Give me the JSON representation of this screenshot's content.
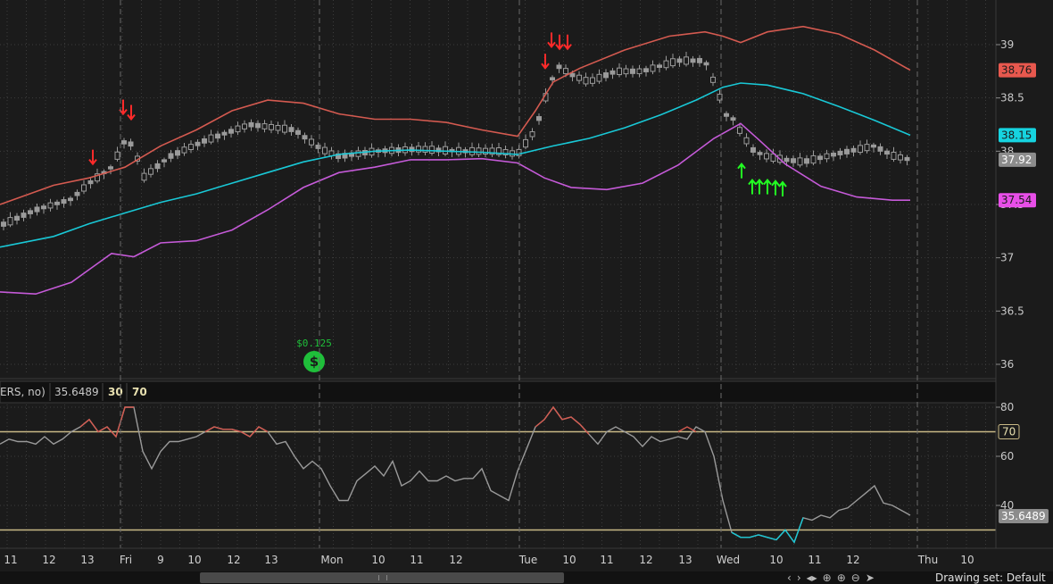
{
  "chart_data": [
    {
      "type": "candlestick",
      "ylim": [
        35.95,
        39.2
      ],
      "y_ticks": [
        "39",
        "38.5",
        "38",
        "37.5",
        "37",
        "36.5",
        "36"
      ],
      "price_badges": [
        {
          "label": "38.76",
          "value": 38.76,
          "color": "#e8584e",
          "text_color": "#1b1b1b"
        },
        {
          "label": "38.15",
          "value": 38.15,
          "color": "#16d4e0",
          "text_color": "#1b1b1b"
        },
        {
          "label": "37.92",
          "value": 37.92,
          "color": "#8c8c8c",
          "text_color": "#ffffff"
        },
        {
          "label": "37.54",
          "value": 37.54,
          "color": "#e84ee8",
          "text_color": "#1b1b1b"
        }
      ],
      "series": [
        {
          "role": "upper-band",
          "color": "#d45a50",
          "x": [
            0,
            60,
            100,
            140,
            180,
            220,
            260,
            300,
            340,
            380,
            420,
            460,
            500,
            540,
            580,
            600,
            620,
            650,
            700,
            750,
            790,
            810,
            830,
            860,
            900,
            940,
            980,
            1020
          ],
          "y": [
            37.5,
            37.68,
            37.75,
            37.85,
            38.05,
            38.2,
            38.38,
            38.48,
            38.45,
            38.35,
            38.3,
            38.3,
            38.27,
            38.2,
            38.14,
            38.38,
            38.65,
            38.78,
            38.95,
            39.08,
            39.12,
            39.08,
            39.02,
            39.12,
            39.17,
            39.1,
            38.95,
            38.76
          ]
        },
        {
          "role": "middle-band",
          "color": "#19c8d6",
          "x": [
            0,
            60,
            100,
            140,
            180,
            220,
            260,
            300,
            340,
            380,
            420,
            460,
            500,
            540,
            580,
            620,
            660,
            700,
            740,
            780,
            810,
            830,
            860,
            900,
            940,
            980,
            1020
          ],
          "y": [
            37.1,
            37.2,
            37.32,
            37.42,
            37.52,
            37.6,
            37.7,
            37.8,
            37.9,
            37.97,
            38.0,
            38.01,
            38.0,
            37.99,
            37.97,
            38.05,
            38.12,
            38.22,
            38.34,
            38.48,
            38.6,
            38.64,
            38.62,
            38.54,
            38.42,
            38.29,
            38.15
          ]
        },
        {
          "role": "lower-band",
          "color": "#c55ad8",
          "x": [
            0,
            40,
            80,
            110,
            125,
            150,
            180,
            220,
            260,
            300,
            340,
            380,
            420,
            460,
            500,
            540,
            580,
            610,
            640,
            680,
            720,
            760,
            800,
            830,
            850,
            880,
            920,
            960,
            1000,
            1020
          ],
          "y": [
            36.68,
            36.66,
            36.77,
            36.95,
            37.04,
            37.01,
            37.14,
            37.16,
            37.26,
            37.45,
            37.66,
            37.8,
            37.85,
            37.92,
            37.92,
            37.93,
            37.89,
            37.75,
            37.66,
            37.64,
            37.7,
            37.87,
            38.12,
            38.26,
            38.11,
            37.88,
            37.67,
            37.57,
            37.54,
            37.54
          ]
        }
      ],
      "markers": {
        "sell_arrows": [
          {
            "x": 104,
            "y": 37.88
          },
          {
            "x": 138,
            "y": 38.35
          },
          {
            "x": 147,
            "y": 38.3
          },
          {
            "x": 611,
            "y": 38.78
          },
          {
            "x": 618,
            "y": 38.98
          },
          {
            "x": 627,
            "y": 38.96
          },
          {
            "x": 636,
            "y": 38.96
          }
        ],
        "buy_arrows": [
          {
            "x": 831,
            "y": 37.88
          },
          {
            "x": 843,
            "y": 37.73
          },
          {
            "x": 851,
            "y": 37.73
          },
          {
            "x": 860,
            "y": 37.73
          },
          {
            "x": 869,
            "y": 37.72
          },
          {
            "x": 877,
            "y": 37.71
          }
        ]
      },
      "dividend": {
        "label": "$0.125",
        "x": 352
      }
    },
    {
      "type": "line",
      "ylim": [
        24,
        83
      ],
      "y_ticks": [
        "80",
        "60",
        "40"
      ],
      "header": {
        "study": "ERS, no)",
        "value": "35.6489",
        "oversold": "30",
        "overbought": "70"
      },
      "levels": [
        {
          "label": "70",
          "value": 70
        },
        {
          "label": "30",
          "value": 30
        }
      ],
      "current_badge": {
        "label": "35.6489",
        "value": 35.6489
      },
      "series": [
        {
          "color": "#9a9a9a",
          "x": [
            0,
            10,
            20,
            30,
            40,
            50,
            60,
            70,
            80,
            90,
            100,
            110,
            120,
            130,
            140,
            150,
            160,
            170,
            180,
            190,
            200,
            210,
            220,
            230,
            240,
            250,
            260,
            270,
            280,
            290,
            300,
            310,
            320,
            330,
            340,
            350,
            360,
            370,
            380,
            390,
            400,
            410,
            420,
            430,
            440,
            450,
            460,
            470,
            480,
            490,
            500,
            510,
            520,
            530,
            540,
            550,
            560,
            570,
            580,
            590,
            600,
            610,
            620,
            630,
            640,
            650,
            660,
            670,
            680,
            690,
            700,
            710,
            720,
            730,
            740,
            750,
            760,
            770,
            780,
            790,
            800,
            810,
            820,
            830,
            840,
            850,
            860,
            870,
            880,
            890,
            900,
            910,
            920,
            930,
            940,
            950,
            960,
            970,
            980,
            990,
            1000,
            1010,
            1020
          ],
          "y": [
            65,
            67,
            66,
            66,
            65,
            68,
            65,
            67,
            70,
            72,
            75,
            70,
            72,
            68,
            80,
            80,
            62,
            55,
            62,
            66,
            66,
            67,
            68,
            70,
            72,
            71,
            71,
            70,
            68,
            72,
            70,
            65,
            66,
            60,
            55,
            58,
            55,
            48,
            42,
            42,
            50,
            53,
            56,
            52,
            58,
            48,
            50,
            54,
            50,
            50,
            52,
            50,
            51,
            51,
            55,
            46,
            44,
            42,
            54,
            63,
            72,
            75,
            80,
            75,
            76,
            73,
            69,
            65,
            70,
            72,
            70,
            68,
            64,
            68,
            66,
            67,
            68,
            67,
            72,
            70,
            60,
            42,
            29,
            27,
            27,
            28,
            27,
            26,
            30,
            25,
            35,
            34,
            36,
            35,
            38,
            39,
            42,
            45,
            48,
            41,
            40,
            38,
            36
          ]
        },
        {
          "color": "#d45a50",
          "x": [
            90,
            100,
            110,
            120,
            130,
            140,
            150
          ],
          "y": [
            72,
            75,
            70,
            72,
            68,
            80,
            80
          ]
        },
        {
          "color": "#d45a50",
          "x": [
            230,
            240,
            250,
            260,
            270,
            280,
            290,
            300
          ],
          "y": [
            70,
            72,
            71,
            71,
            70,
            68,
            72,
            70
          ]
        },
        {
          "color": "#d45a50",
          "x": [
            600,
            610,
            620,
            630,
            640,
            650,
            660
          ],
          "y": [
            72,
            75,
            80,
            75,
            76,
            73,
            69
          ]
        },
        {
          "color": "#d45a50",
          "x": [
            760,
            770,
            780
          ],
          "y": [
            70,
            72,
            70
          ]
        },
        {
          "color": "#19c8d6",
          "x": [
            820,
            830,
            840,
            850,
            860,
            870,
            880,
            890,
            900
          ],
          "y": [
            29,
            27,
            27,
            28,
            27,
            26,
            30,
            25,
            35
          ]
        }
      ]
    }
  ],
  "x_axis": {
    "labels": [
      {
        "text": "11",
        "x": 12
      },
      {
        "text": "12",
        "x": 55
      },
      {
        "text": "13",
        "x": 98
      },
      {
        "text": "Fri",
        "x": 141
      },
      {
        "text": "9",
        "x": 180
      },
      {
        "text": "10",
        "x": 218
      },
      {
        "text": "12",
        "x": 262
      },
      {
        "text": "13",
        "x": 304
      },
      {
        "text": "Mon",
        "x": 372
      },
      {
        "text": "10",
        "x": 424
      },
      {
        "text": "11",
        "x": 467
      },
      {
        "text": "12",
        "x": 511
      },
      {
        "text": "Tue",
        "x": 592
      },
      {
        "text": "10",
        "x": 638
      },
      {
        "text": "11",
        "x": 680
      },
      {
        "text": "12",
        "x": 724
      },
      {
        "text": "13",
        "x": 768
      },
      {
        "text": "Wed",
        "x": 816
      },
      {
        "text": "10",
        "x": 870
      },
      {
        "text": "11",
        "x": 913
      },
      {
        "text": "12",
        "x": 956
      },
      {
        "text": "Thu",
        "x": 1040
      },
      {
        "text": "10",
        "x": 1084
      }
    ],
    "day_separators": [
      135,
      358,
      582,
      808,
      1028
    ]
  },
  "toolbar": {
    "drawing_set": "Drawing set: Default"
  },
  "colors": {
    "background": "#1b1b1b",
    "grid": "#3c3c3c",
    "candle": "#9a9a9a",
    "sell": "#ff2a2a",
    "buy": "#22ff22",
    "dividend": "#1fbf3a",
    "level_line": "#c9b986"
  }
}
